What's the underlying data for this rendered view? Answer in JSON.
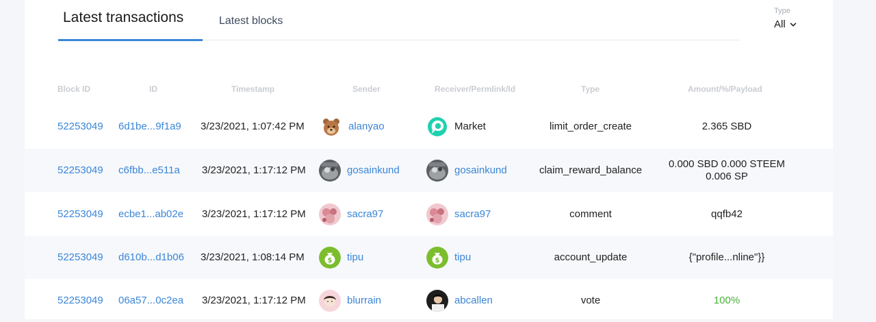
{
  "tabs": {
    "latest_transactions": "Latest transactions",
    "latest_blocks": "Latest blocks"
  },
  "type_filter": {
    "label": "Type",
    "value": "All"
  },
  "table": {
    "headers": [
      "Block ID",
      "ID",
      "Timestamp",
      "Sender",
      "Receiver/Permlink/Id",
      "Type",
      "Amount/%/Payload"
    ],
    "rows": [
      {
        "block_id": "52253049",
        "id": "6d1be...9f1a9",
        "timestamp": "3/23/2021, 1:07:42 PM",
        "sender": "alanyao",
        "sender_avatar": "bear-avatar",
        "receiver": "Market",
        "receiver_avatar": "market-logo",
        "type": "limit_order_create",
        "amount": "2.365 SBD"
      },
      {
        "block_id": "52253049",
        "id": "c6fbb...e511a",
        "timestamp": "3/23/2021, 1:17:12 PM",
        "sender": "gosainkund",
        "sender_avatar": "gosainkund-avatar",
        "receiver": "gosainkund",
        "receiver_avatar": "gosainkund-avatar",
        "type": "claim_reward_balance",
        "amount_line1": "0.000 SBD 0.000 STEEM",
        "amount_line2": "0.006 SP"
      },
      {
        "block_id": "52253049",
        "id": "ecbe1...ab02e",
        "timestamp": "3/23/2021, 1:17:12 PM",
        "sender": "sacra97",
        "sender_avatar": "sacra97-avatar",
        "receiver": "sacra97",
        "receiver_avatar": "sacra97-avatar",
        "type": "comment",
        "amount": "qqfb42"
      },
      {
        "block_id": "52253049",
        "id": "d610b...d1b06",
        "timestamp": "3/23/2021, 1:08:14 PM",
        "sender": "tipu",
        "sender_avatar": "money-bag-avatar",
        "receiver": "tipu",
        "receiver_avatar": "money-bag-avatar",
        "type": "account_update",
        "amount": "{\"profile...nline\"}}"
      },
      {
        "block_id": "52253049",
        "id": "06a57...0c2ea",
        "timestamp": "3/23/2021, 1:17:12 PM",
        "sender": "blurrain",
        "sender_avatar": "blurrain-avatar",
        "receiver": "abcallen",
        "receiver_avatar": "abcallen-avatar",
        "type": "vote",
        "amount": "100%"
      }
    ]
  },
  "colors": {
    "link": "#3a86d8",
    "accent": "#3a86d8",
    "success": "#46b336"
  }
}
